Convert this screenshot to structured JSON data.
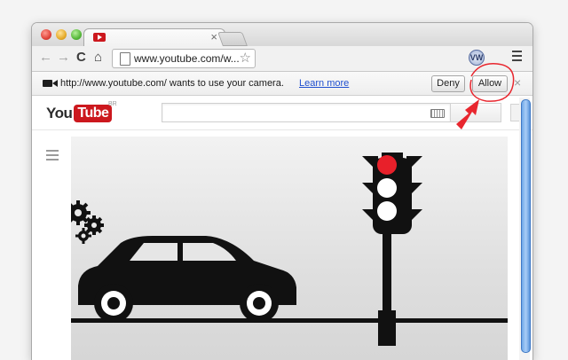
{
  "browser": {
    "tab": {
      "favicon": "youtube-favicon",
      "close_label": "×"
    },
    "toolbar": {
      "back_icon": "←",
      "forward_icon": "→",
      "reload_icon": "C",
      "home_icon": "⌂",
      "url": "www.youtube.com/w...",
      "star_icon": "☆",
      "extension_icon": "VW",
      "menu_icon": "menu-icon"
    },
    "infobar": {
      "message": "http://www.youtube.com/ wants to use your camera.",
      "learn_more": "Learn more",
      "deny_label": "Deny",
      "allow_label": "Allow",
      "close_label": "×"
    }
  },
  "youtube": {
    "logo_you": "You",
    "logo_tube": "Tube",
    "region": "BR",
    "search_placeholder": ""
  },
  "colors": {
    "youtube_red": "#cc181e",
    "annotation_red": "#e8262e",
    "link_blue": "#1f4fcf",
    "traffic_light_red": "#e8202a"
  }
}
